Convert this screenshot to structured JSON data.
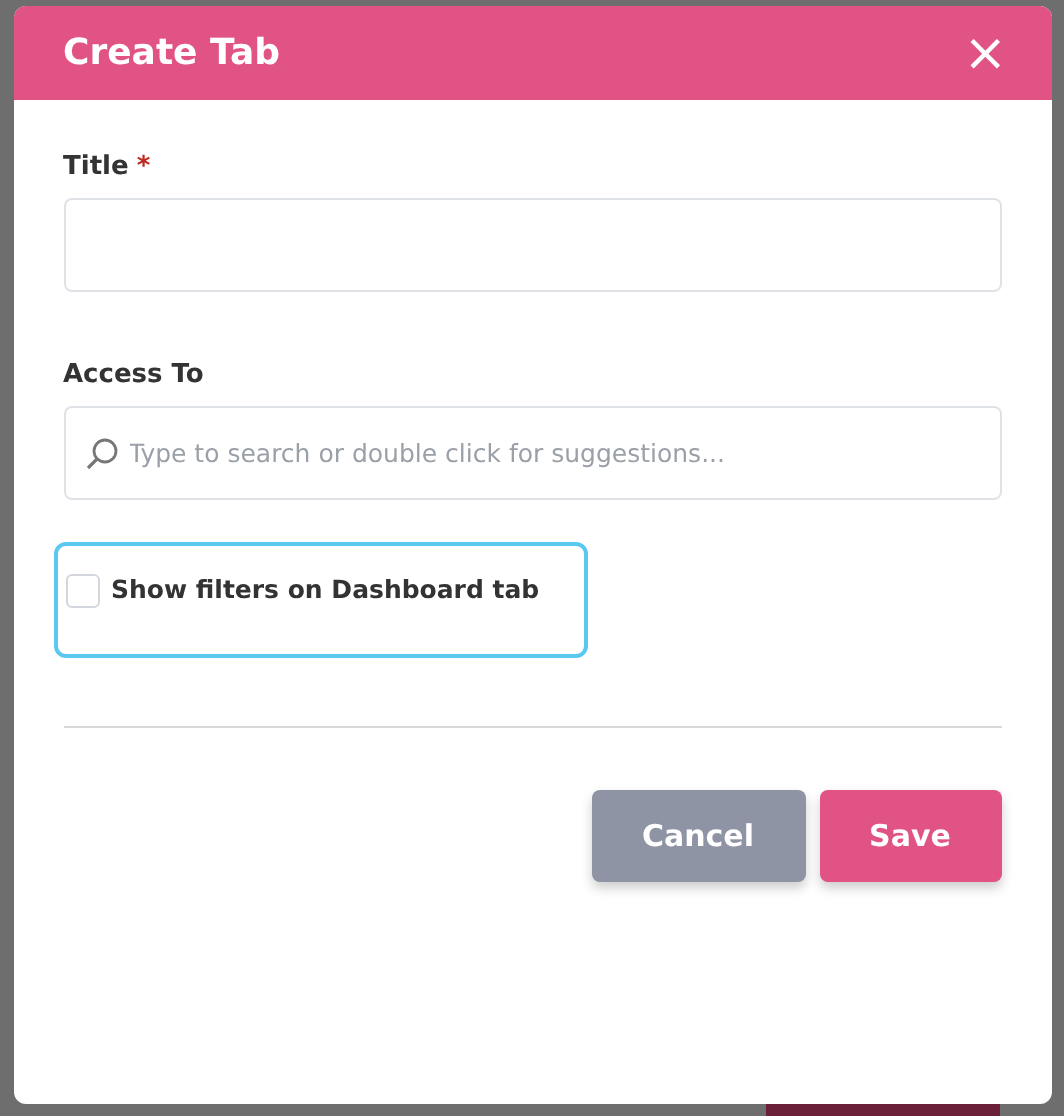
{
  "dialog": {
    "title": "Create Tab",
    "close": "×"
  },
  "fields": [
    {
      "kind": "text",
      "label": "Title",
      "required_mark": "*"
    },
    {
      "kind": "search",
      "label": "Access To",
      "placeholder": "Type to search or double click for suggestions..."
    }
  ],
  "checkbox": {
    "label": "Show filters on Dashboard tab",
    "checked": false,
    "focused": true
  },
  "buttons": [
    {
      "label": "Cancel",
      "kind": "secondary"
    },
    {
      "label": "Save",
      "kind": "primary"
    }
  ]
}
